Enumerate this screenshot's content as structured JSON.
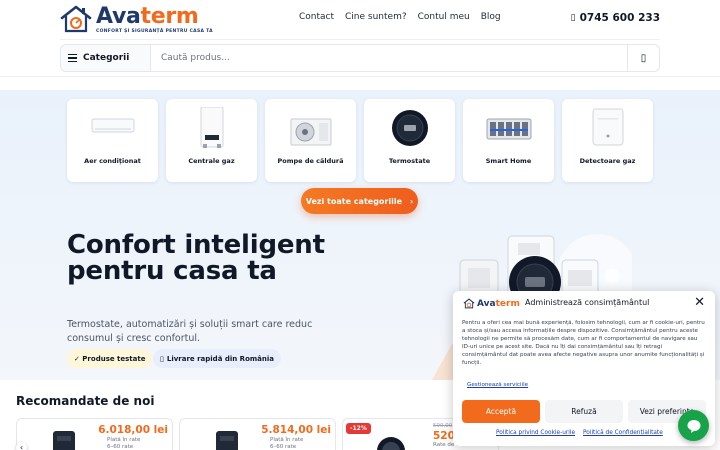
{
  "brand": {
    "name_part1": "Ava",
    "name_part2": "term",
    "tagline": "CONFORT ȘI SIGURANȚĂ PENTRU CASA TA",
    "color_primary": "#1e3a6b",
    "color_accent": "#f26a1b"
  },
  "nav": {
    "items": [
      "Contact",
      "Cine suntem?",
      "Contul meu",
      "Blog"
    ]
  },
  "phone": {
    "icon": "phone-icon",
    "number": "0745 600 233"
  },
  "search": {
    "categories_label": "Categorii",
    "placeholder": "Caută produs...",
    "button_icon": "search-icon"
  },
  "categories": [
    {
      "label": "Aer condiționat",
      "icon": "air-conditioner-icon"
    },
    {
      "label": "Centrale gaz",
      "icon": "gas-boiler-icon"
    },
    {
      "label": "Pompe de căldură",
      "icon": "heat-pump-icon"
    },
    {
      "label": "Termostate",
      "icon": "thermostat-icon"
    },
    {
      "label": "Smart Home",
      "icon": "smart-home-icon"
    },
    {
      "label": "Detectoare gaz",
      "icon": "gas-detector-icon"
    }
  ],
  "all_categories_button": "Vezi toate categoriile",
  "hero": {
    "title": "Confort inteligent pentru casa ta",
    "subtitle": "Termostate, automatizări și soluții smart care reduc consumul și cresc confortul.",
    "badge_tested": "✓ Produse testate",
    "badge_delivery": "Livrare rapidă din România"
  },
  "recommendations": {
    "title": "Recomandate de noi",
    "products": [
      {
        "price": "6.018,00 lei",
        "rate": "Plată în rate",
        "rate_range": "6–60 rate"
      },
      {
        "price": "5.814,00 lei",
        "rate": "Plată în rate",
        "rate_range": "6–60 rate"
      },
      {
        "price": "520",
        "old_price": "590,00",
        "rate": "Rate de la",
        "discount": "-12%"
      }
    ]
  },
  "consent": {
    "logo_part1": "Ava",
    "logo_part2": "term",
    "title": "Administrează consimțământul",
    "body": "Pentru a oferi cea mai bună experiență, folosim tehnologii, cum ar fi cookie-uri, pentru a stoca și/sau accesa informațiile despre dispozitive. Consimțământul pentru aceste tehnologii ne permite să procesăm date, cum ar fi comportamentul de navigare sau ID-uri unice pe acest site. Dacă nu îți dai consimțământul sau îți retragi consimțământul dat poate avea afecte negative asupra unor anumite funcționalități și funcții.",
    "manage_link": "Gestionează serviciile",
    "accept": "Acceptă",
    "deny": "Refuză",
    "preferences": "Vezi preferințe",
    "cookie_policy": "Politica privind Cookie-urile",
    "privacy_policy": "Politică de Confidențialitate"
  }
}
